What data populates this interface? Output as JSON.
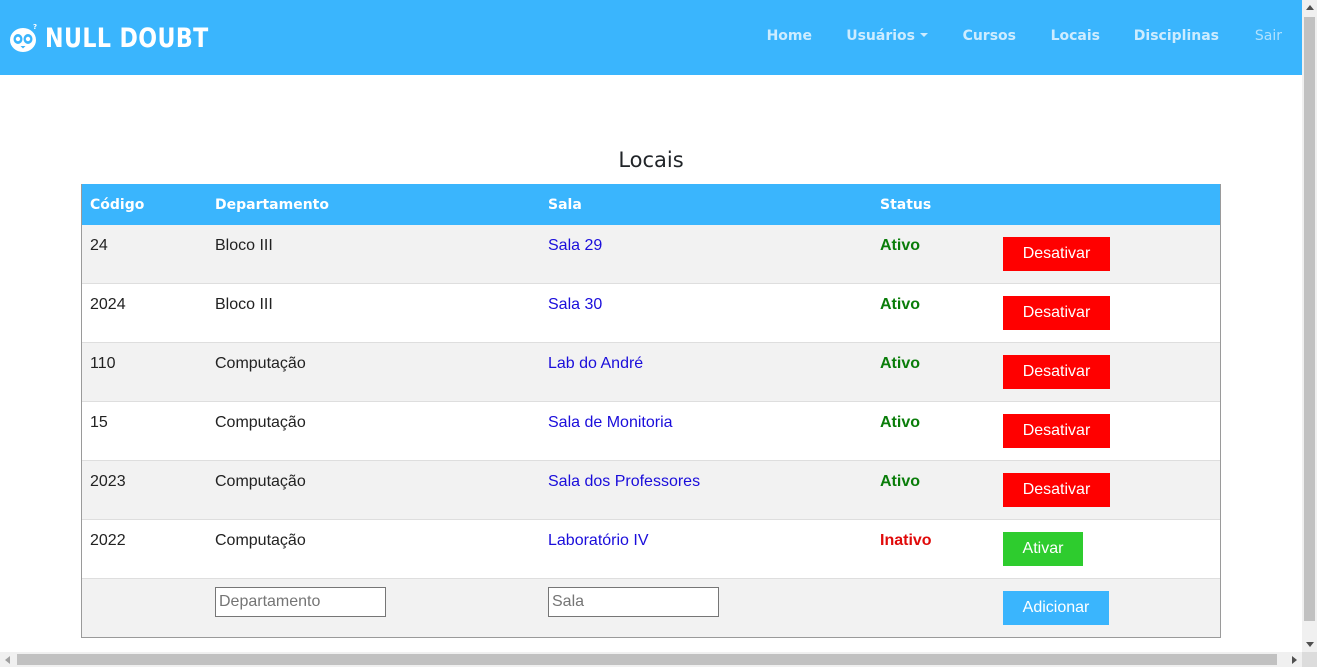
{
  "brand": {
    "name": "NULL DOUBT",
    "logo_icon": "penguin-icon"
  },
  "nav": {
    "home": "Home",
    "usuarios": "Usuários",
    "cursos": "Cursos",
    "locais": "Locais",
    "disciplinas": "Disciplinas",
    "sair": "Sair"
  },
  "page_title": "Locais",
  "table": {
    "headers": {
      "codigo": "Código",
      "departamento": "Departamento",
      "sala": "Sala",
      "status": "Status"
    },
    "rows": [
      {
        "codigo": "24",
        "departamento": "Bloco III",
        "sala": "Sala 29",
        "status": "Ativo",
        "action": "Desativar"
      },
      {
        "codigo": "2024",
        "departamento": "Bloco III",
        "sala": "Sala 30",
        "status": "Ativo",
        "action": "Desativar"
      },
      {
        "codigo": "110",
        "departamento": "Computação",
        "sala": "Lab do André",
        "status": "Ativo",
        "action": "Desativar"
      },
      {
        "codigo": "15",
        "departamento": "Computação",
        "sala": "Sala de Monitoria",
        "status": "Ativo",
        "action": "Desativar"
      },
      {
        "codigo": "2023",
        "departamento": "Computação",
        "sala": "Sala dos Professores",
        "status": "Ativo",
        "action": "Desativar"
      },
      {
        "codigo": "2022",
        "departamento": "Computação",
        "sala": "Laboratório IV",
        "status": "Inativo",
        "action": "Ativar"
      }
    ],
    "add_row": {
      "departamento_placeholder": "Departamento",
      "sala_placeholder": "Sala",
      "add_label": "Adicionar"
    }
  },
  "colors": {
    "brand_blue": "#3ab5fd",
    "active_green": "#0a7d0a",
    "inactive_red": "#e00a0a",
    "deactivate_button": "#ff0000",
    "activate_button": "#2ecc2e",
    "link_blue": "#1a0ddb"
  }
}
